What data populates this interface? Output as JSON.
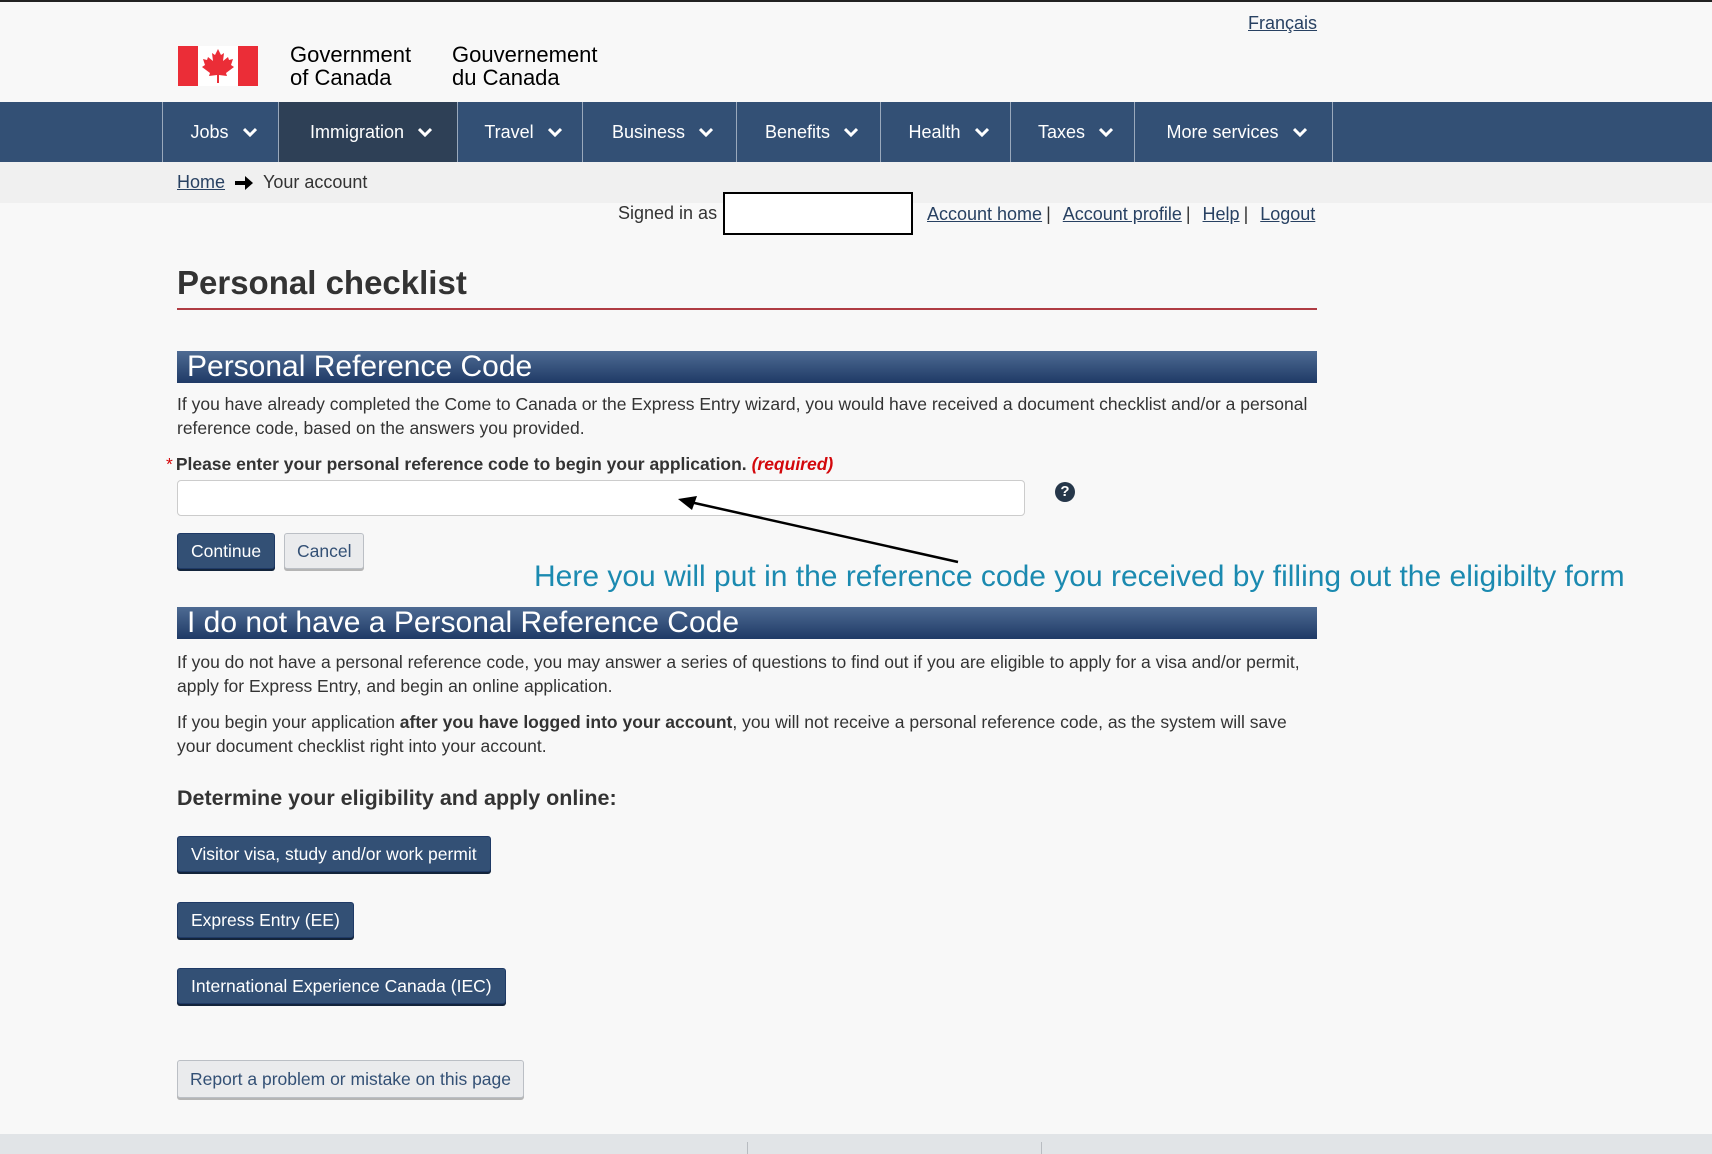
{
  "header": {
    "language_link": "Français",
    "wordmark_en_line1": "Government",
    "wordmark_en_line2": "of Canada",
    "wordmark_fr_line1": "Gouvernement",
    "wordmark_fr_line2": "du Canada"
  },
  "menu": {
    "items": [
      {
        "label": "Jobs"
      },
      {
        "label": "Immigration",
        "active": true
      },
      {
        "label": "Travel"
      },
      {
        "label": "Business"
      },
      {
        "label": "Benefits"
      },
      {
        "label": "Health"
      },
      {
        "label": "Taxes"
      },
      {
        "label": "More services"
      }
    ]
  },
  "breadcrumb": {
    "home": "Home",
    "current": "Your account"
  },
  "account": {
    "signed_in_as": "Signed in as",
    "links": [
      "Account home",
      "Account profile",
      "Help",
      "Logout"
    ]
  },
  "page": {
    "title": "Personal checklist"
  },
  "reference_section": {
    "heading": "Personal Reference Code",
    "intro": "If you have already completed the Come to Canada or the Express Entry wizard, you would have received a document checklist and/or a personal reference code, based on the answers you provided.",
    "field_label": "Please enter your personal reference code to begin your application.",
    "required_text": "(required)",
    "required_marker": "*",
    "input_value": "",
    "continue_label": "Continue",
    "cancel_label": "Cancel"
  },
  "annotation": {
    "text": "Here you will put in the reference code you received by filling out the eligibilty form"
  },
  "no_code_section": {
    "heading": "I do not have a Personal Reference Code",
    "para1": "If you do not have a personal reference code, you may answer a series of questions to find out if you are eligible to apply for a visa and/or permit, apply for Express Entry, and begin an online application.",
    "para2_before": "If you begin your application ",
    "para2_bold": "after you have logged into your account",
    "para2_after": ", you will not receive a personal reference code, as the system will save your document checklist right into your account.",
    "subheading": "Determine your eligibility and apply online:",
    "buttons": [
      "Visitor visa, study and/or work permit",
      "Express Entry (EE)",
      "International Experience Canada (IEC)"
    ]
  },
  "report_button": "Report a problem or mistake on this page",
  "colors": {
    "nav_bg": "#335075",
    "accent_red": "#af3c43",
    "required_red": "#d3080c",
    "annotation_blue": "#1b8ab0"
  }
}
